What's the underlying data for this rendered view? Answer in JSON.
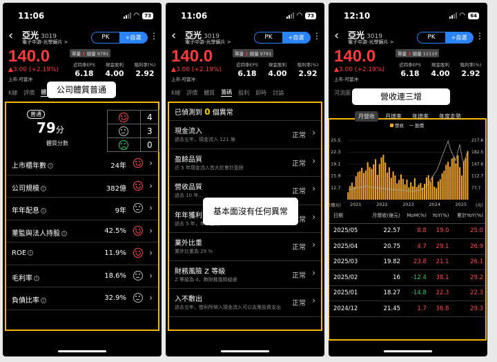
{
  "common": {
    "stock_name": "亞光",
    "stock_code": "3019",
    "stock_sub": "電子中游-光學鏡片 >",
    "pk_label": "PK",
    "add_label": "+自選",
    "more_icon": "more-vert-icon",
    "market": "上市-可當沖",
    "eps_label": "近四季EPS",
    "dividend_label": "現金股利",
    "yield_label": "殖利率(%)",
    "eps_value": "6.18",
    "dividend_value": "4.00",
    "yield_value": "2.92"
  },
  "screens": [
    {
      "time": "11:06",
      "battery": "73",
      "price": "140.0",
      "change": "▲3.00 (+2.19%)",
      "volume_label": "單量",
      "volume_value": "1",
      "total_label": "總量",
      "total_value": "9781",
      "tabs": [
        "K線",
        "評價",
        "體質",
        "籌碼",
        "股利",
        "即時",
        "新"
      ],
      "active_tab": "體質"
    },
    {
      "time": "11:06",
      "battery": "73",
      "price": "140.0",
      "change": "▲3.00 (+2.19%)",
      "volume_label": "單量",
      "volume_value": "1",
      "total_label": "總量",
      "total_value": "9781",
      "tabs": [
        "K線",
        "評價",
        "體質",
        "籌碼",
        "股利",
        "即時",
        "討論"
      ],
      "active_tab": "籌碼"
    },
    {
      "time": "12:10",
      "battery": "64",
      "price": "140.0",
      "change": "▲3.00 (+2.19%)",
      "volume_label": "單量",
      "volume_value": "1",
      "total_label": "總量",
      "total_value": "11110",
      "tabs": [
        "河流圖",
        "",
        "",
        "",
        "",
        "法人"
      ],
      "active_tab": ""
    }
  ],
  "panel1": {
    "callout": "公司體質普通",
    "badge": "普通",
    "score": "79",
    "score_unit": "分",
    "score_label": "體質分數",
    "counts": {
      "good": "4",
      "neutral": "3",
      "bad": "0"
    },
    "rows": [
      {
        "label": "上市櫃年數",
        "value": "24年",
        "face": "red"
      },
      {
        "label": "公司規模",
        "value": "382億",
        "face": "red"
      },
      {
        "label": "年年配息",
        "value": "9年",
        "face": "grey"
      },
      {
        "label": "董監與法人持股",
        "value": "42.5%",
        "face": "red"
      },
      {
        "label": "ROE",
        "value": "11.9%",
        "face": "red"
      },
      {
        "label": "毛利率",
        "value": "18.6%",
        "face": "grey"
      },
      {
        "label": "負債比率",
        "value": "32.9%",
        "face": "grey"
      }
    ]
  },
  "panel2": {
    "head_prefix": "已偵測到",
    "head_count": "0",
    "head_suffix": "個異常",
    "callout": "基本面沒有任何異常",
    "items": [
      {
        "title": "現金流入",
        "desc": "過去五年，現金流入 121 億",
        "status": "正常"
      },
      {
        "title": "盈餘品質",
        "desc": "近 5 年現金流入皆大於會計盈餘",
        "status": "正常"
      },
      {
        "title": "營收品質",
        "desc": "過去 10 年…",
        "status": "正常"
      },
      {
        "title": "年年獲利",
        "desc": "過去 5 年，年年獲利",
        "status": "正常"
      },
      {
        "title": "業外比重",
        "desc": "業外比重為 29 %",
        "status": "正常"
      },
      {
        "title": "財務風險 Z 等級",
        "desc": "Z 等級為 4，無財務風險疑慮",
        "status": "正常"
      },
      {
        "title": "入不敷出",
        "desc": "過去五年，營利所帶入現金流入可以支應投資支出",
        "status": "正常"
      }
    ]
  },
  "panel3": {
    "callout": "營收連三增",
    "subtabs": [
      "月營收",
      "月增率",
      "年增率",
      "年度走勢"
    ],
    "active_subtab": "月營收",
    "legend": [
      "營收",
      "股價"
    ],
    "yunit": "(億元)",
    "yunit_right": "(元)",
    "table_headers": [
      "日期",
      "月營收(億元)",
      "MoM(%)",
      "YoY(%)",
      "累計YoY(%)"
    ],
    "rows": [
      {
        "date": "2025/05",
        "rev": "22.57",
        "mom": "8.8",
        "yoy": "19.0",
        "cum": "25.0",
        "mom_color": "red"
      },
      {
        "date": "2025/04",
        "rev": "20.75",
        "mom": "4.7",
        "yoy": "29.1",
        "cum": "26.9",
        "mom_color": "red"
      },
      {
        "date": "2025/03",
        "rev": "19.82",
        "mom": "23.8",
        "yoy": "21.1",
        "cum": "26.1",
        "mom_color": "red"
      },
      {
        "date": "2025/02",
        "rev": "16",
        "mom": "-12.4",
        "yoy": "38.1",
        "cum": "29.2",
        "mom_color": "green"
      },
      {
        "date": "2025/01",
        "rev": "18.27",
        "mom": "-14.8",
        "yoy": "22.3",
        "cum": "22.3",
        "mom_color": "green"
      },
      {
        "date": "2024/12",
        "rev": "21.45",
        "mom": "1.7",
        "yoy": "36.8",
        "cum": "29.3",
        "mom_color": "red"
      }
    ]
  },
  "chart_data": {
    "type": "bar",
    "title": "",
    "x_ticks": [
      "2021",
      "2022",
      "2023",
      "2024",
      "2025"
    ],
    "y_ticks": [
      "25.5",
      "22.3",
      "19.1",
      "15.9",
      "12.7"
    ],
    "y2_ticks": [
      "217.6",
      "182.5",
      "147.6",
      "112.7",
      "77.7"
    ],
    "ylim": [
      9.5,
      27
    ],
    "series": [
      {
        "name": "營收",
        "values": [
          11.5,
          13.2,
          14.1,
          13.0,
          15.8,
          16.9,
          17.2,
          18.1,
          16.7,
          17.4,
          19.6,
          18.3,
          17.8,
          19.0,
          20.4,
          16.2,
          19.1,
          20.9,
          21.6,
          19.5,
          16.8,
          18.2,
          15.4,
          17.1,
          16.0,
          13.9,
          14.8,
          16.3,
          15.1,
          13.6,
          14.9,
          12.8,
          14.2,
          13.1,
          15.3,
          12.9,
          13.5,
          14.0,
          12.7,
          13.8,
          15.5,
          16.1,
          14.3,
          15.7,
          13.0,
          12.6,
          14.4,
          15.0,
          16.6,
          17.3,
          18.9,
          19.7,
          18.4,
          20.6,
          21.0,
          19.3,
          21.45,
          18.27,
          16.0,
          19.82,
          20.75,
          22.57
        ]
      },
      {
        "name": "股價",
        "values": [
          12.2,
          12.0,
          12.6,
          12.3,
          12.9,
          12.7,
          12.8,
          13.0,
          12.9,
          13.4,
          13.2,
          13.0,
          12.8,
          12.6,
          12.9,
          12.7,
          12.5,
          12.4,
          12.6,
          12.3,
          12.5,
          12.2,
          12.4,
          12.1,
          12.3,
          12.0,
          12.2,
          11.9,
          12.1,
          12.0,
          11.8,
          12.0,
          11.7,
          11.9,
          11.8,
          12.0,
          11.9,
          12.1,
          12.4,
          12.8,
          13.2,
          13.9,
          14.8,
          15.6,
          16.5,
          17.2,
          18.4,
          19.8,
          21.3,
          22.6,
          24.1,
          25.3,
          23.4,
          22.0,
          21.1,
          20.0,
          22.6,
          24.4,
          21.0,
          19.3,
          20.8,
          22.7
        ]
      }
    ]
  }
}
